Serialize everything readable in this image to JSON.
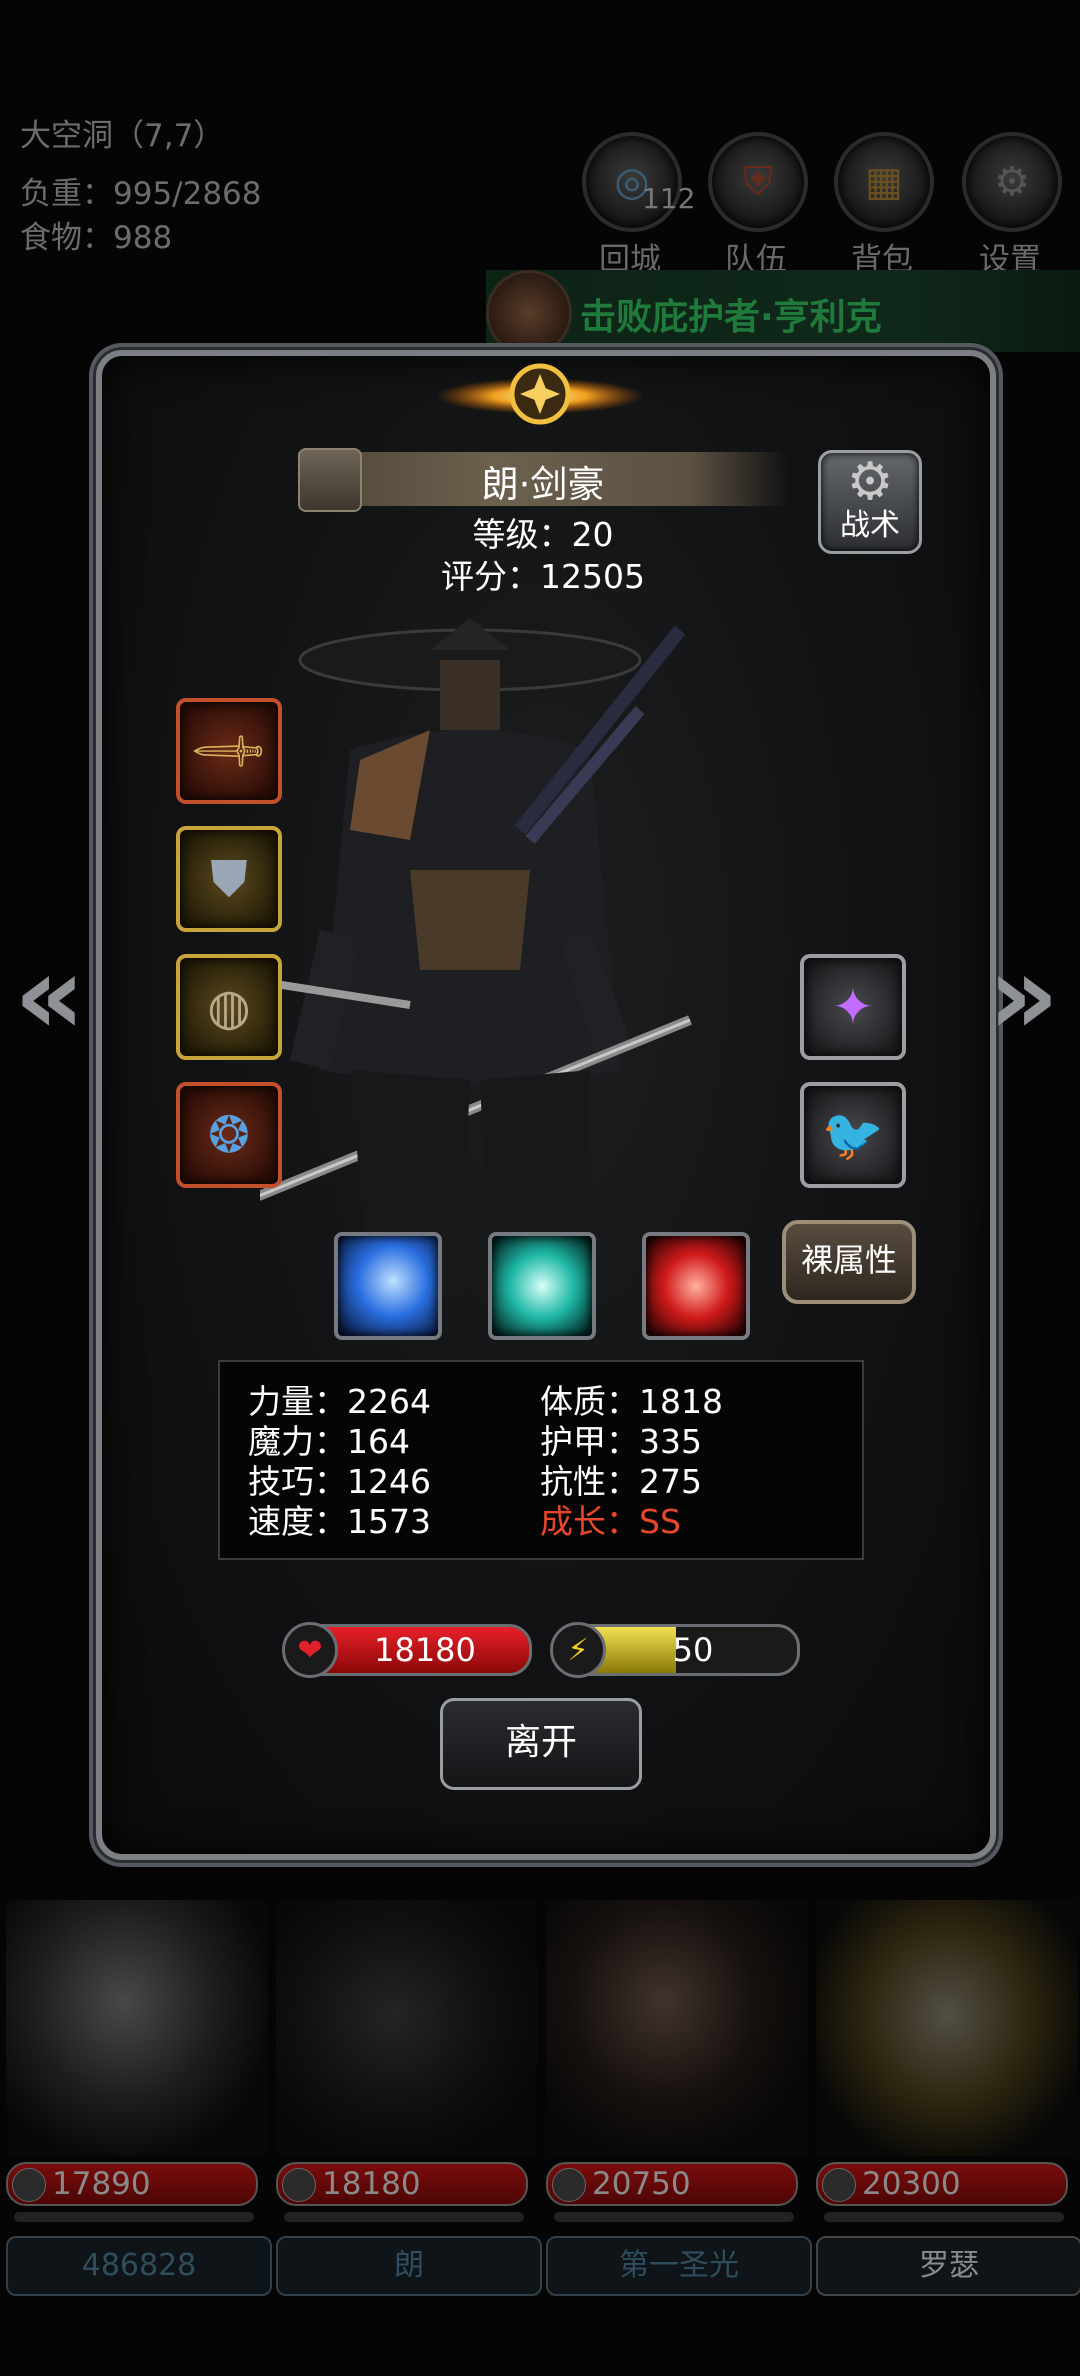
{
  "hud": {
    "location": "大空洞（7,7）",
    "weight": "负重：995/2868",
    "food": "食物：988"
  },
  "menu": [
    {
      "label": "回城",
      "icon": "portal-icon",
      "badge": "112"
    },
    {
      "label": "队伍",
      "icon": "shield-icon"
    },
    {
      "label": "背包",
      "icon": "chest-icon"
    },
    {
      "label": "设置",
      "icon": "gear-icon"
    }
  ],
  "quest": {
    "text": "击败庇护者·亨利克",
    "icon": "quest-scroll-icon"
  },
  "hero": {
    "name": "朗·剑豪",
    "level": "等级：20",
    "score": "评分：12505",
    "tactic_label": "战术",
    "naked_label": "裸属性",
    "leave_label": "离开",
    "hp_value": "18180",
    "energy_value": "50",
    "energy_fraction": 0.5
  },
  "equipment_left": [
    {
      "icon": "dagger-icon",
      "rarity": "red"
    },
    {
      "icon": "armor-icon",
      "rarity": "gold"
    },
    {
      "icon": "ring-icon",
      "rarity": "gold"
    },
    {
      "icon": "amulet-icon",
      "rarity": "red"
    }
  ],
  "equipment_right": [
    {
      "icon": "lantern-icon",
      "rarity": "silver"
    },
    {
      "icon": "raven-icon",
      "rarity": "silver"
    }
  ],
  "skills": [
    {
      "icon": "blue-slash-skill-icon",
      "color": "#4a8cff"
    },
    {
      "icon": "teal-slash-skill-icon",
      "color": "#3fd6c2"
    },
    {
      "icon": "red-slash-skill-icon",
      "color": "#e0282a"
    }
  ],
  "stats_left": [
    "力量：2264",
    "魔力：164",
    "技巧：1246",
    "速度：1573"
  ],
  "stats_right": [
    "体质：1818",
    "护甲：335",
    "抗性：275",
    "成长：SS"
  ],
  "roster": [
    {
      "hp": "17890",
      "name": "486828",
      "lit": false
    },
    {
      "hp": "18180",
      "name": "朗",
      "lit": false
    },
    {
      "hp": "20750",
      "name": "第一圣光",
      "lit": false
    },
    {
      "hp": "20300",
      "name": "罗瑟",
      "lit": true
    }
  ],
  "colors": {
    "growth": "#e8472b",
    "quest": "#1f7a3c",
    "hp_bar": "#c8101a",
    "energy_bar": "#d8c21a"
  }
}
